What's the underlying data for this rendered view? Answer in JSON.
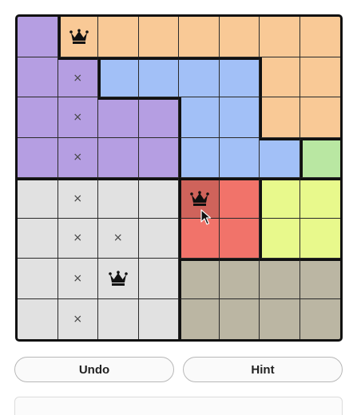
{
  "game": {
    "size": 8,
    "colors": {
      "P": "#b59ee2",
      "O": "#f9c996",
      "B": "#a2c0f7",
      "G": "#b9e7a2",
      "L": "#e1e1e1",
      "R": "#f1736a",
      "Y": "#e8f98c",
      "T": "#bbb6a3"
    },
    "regions": [
      "POOOOOOO",
      "PPBBBBOO",
      "PPPPBBOO",
      "PPPPBBBG",
      "LLLLRRYY",
      "LLLLRRYY",
      "LLLLTTTT",
      "LLLLTTTT"
    ],
    "marks": [
      "-Q------",
      "-x------",
      "-x------",
      "-x------",
      "-x--Q---",
      "-xx-----",
      "-xQ-----",
      "-x------"
    ],
    "highlight_cell": [
      4,
      4
    ],
    "icons": {
      "queen": "crown-icon",
      "mark": "x-mark-icon",
      "cursor": "mouse-pointer-icon"
    }
  },
  "controls": {
    "undo_label": "Undo",
    "hint_label": "Hint"
  }
}
